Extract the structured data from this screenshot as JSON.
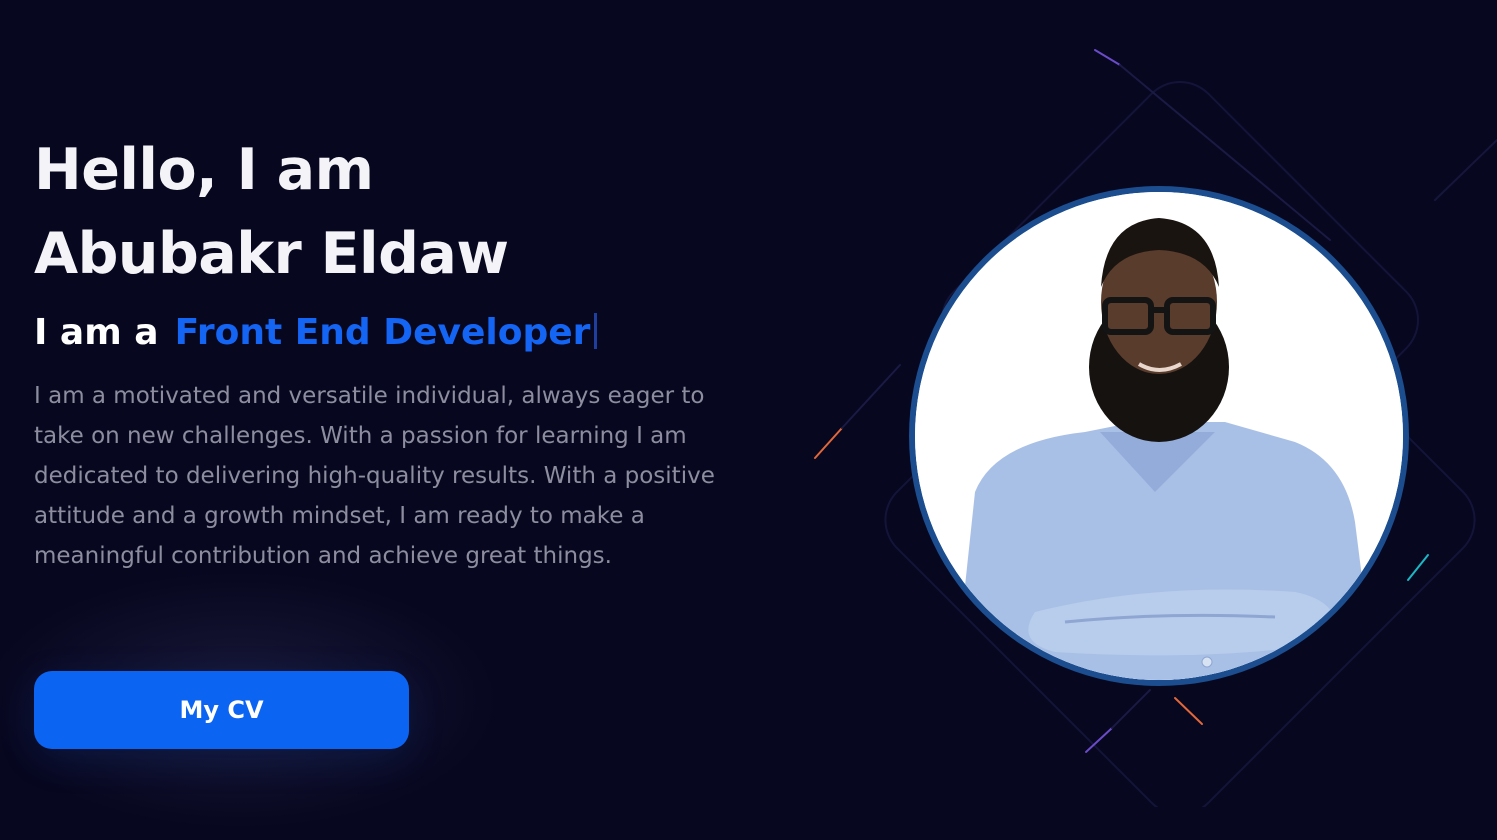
{
  "hero": {
    "headline_line1": "Hello, I am",
    "headline_line2": "Abubakr Eldaw",
    "role_prefix": "I am a",
    "role_typed": "Front End Developer",
    "intro": "I am a motivated and versatile individual, always eager to take on new challenges. With a passion for learning I am dedicated to delivering high-quality results. With a positive attitude and a growth mindset, I am ready to make a meaningful contribution and achieve great things.",
    "cv_button_label": "My CV"
  },
  "colors": {
    "background": "#07071f",
    "accent": "#0c64f2",
    "typed_text": "#1565f5",
    "body_text": "#8d8d9f",
    "portrait_ring": "#1c4e8f"
  },
  "portrait": {
    "icon": "person-portrait"
  }
}
